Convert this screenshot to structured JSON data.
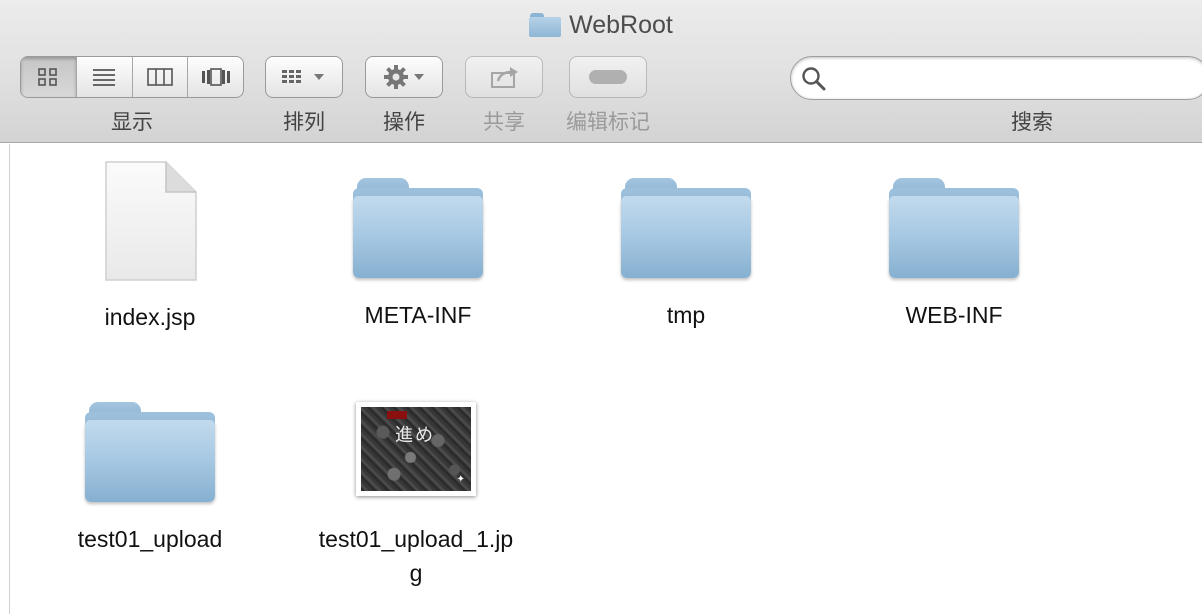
{
  "window": {
    "title": "WebRoot"
  },
  "toolbar": {
    "view_label": "显示",
    "arrange_label": "排列",
    "action_label": "操作",
    "share_label": "共享",
    "edit_tags_label": "编辑标记",
    "search_label": "搜索",
    "view_modes": [
      "icon-view",
      "list-view",
      "column-view",
      "cover-flow-view"
    ],
    "active_view": "icon-view"
  },
  "search": {
    "value": "",
    "placeholder": ""
  },
  "files": [
    {
      "name": "index.jsp",
      "kind": "document-icon"
    },
    {
      "name": "META-INF",
      "kind": "folder-icon"
    },
    {
      "name": "tmp",
      "kind": "folder-icon"
    },
    {
      "name": "WEB-INF",
      "kind": "folder-icon"
    },
    {
      "name": "test01_upload",
      "kind": "folder-icon"
    },
    {
      "name_line1": "test01_upload_1.jp",
      "name_line2": "g",
      "kind": "image-thumbnail"
    }
  ],
  "colors": {
    "folder": "#a9cae4",
    "toolbar": "#e0e0e0"
  }
}
